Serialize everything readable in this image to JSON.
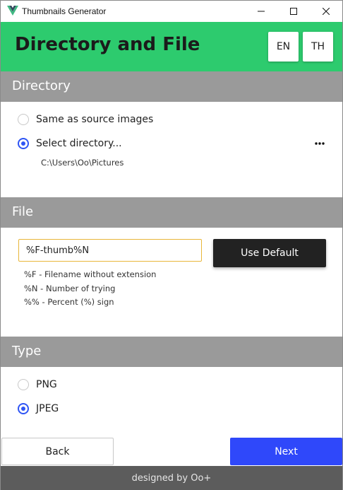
{
  "window": {
    "title": "Thumbnails Generator"
  },
  "header": {
    "title": "Directory and File",
    "lang_en": "EN",
    "lang_th": "TH",
    "accent": "#2dcb6e"
  },
  "directory": {
    "section_title": "Directory",
    "option_same": "Same as source images",
    "option_select": "Select directory...",
    "selected": "select",
    "path": "C:\\Users\\Oo\\Pictures"
  },
  "file": {
    "section_title": "File",
    "pattern_value": "%F-thumb%N",
    "use_default_label": "Use Default",
    "hints": [
      "%F - Filename without extension",
      "%N - Number of trying",
      "%% - Percent (%) sign"
    ]
  },
  "type": {
    "section_title": "Type",
    "option_png": "PNG",
    "option_jpeg": "JPEG",
    "selected": "jpeg"
  },
  "footer": {
    "back_label": "Back",
    "next_label": "Next",
    "credit": "designed by Oo+",
    "next_color": "#2f48fa"
  },
  "icons": [
    "vue-logo-icon",
    "minimize-icon",
    "maximize-icon",
    "close-icon",
    "more-horizontal-icon"
  ]
}
